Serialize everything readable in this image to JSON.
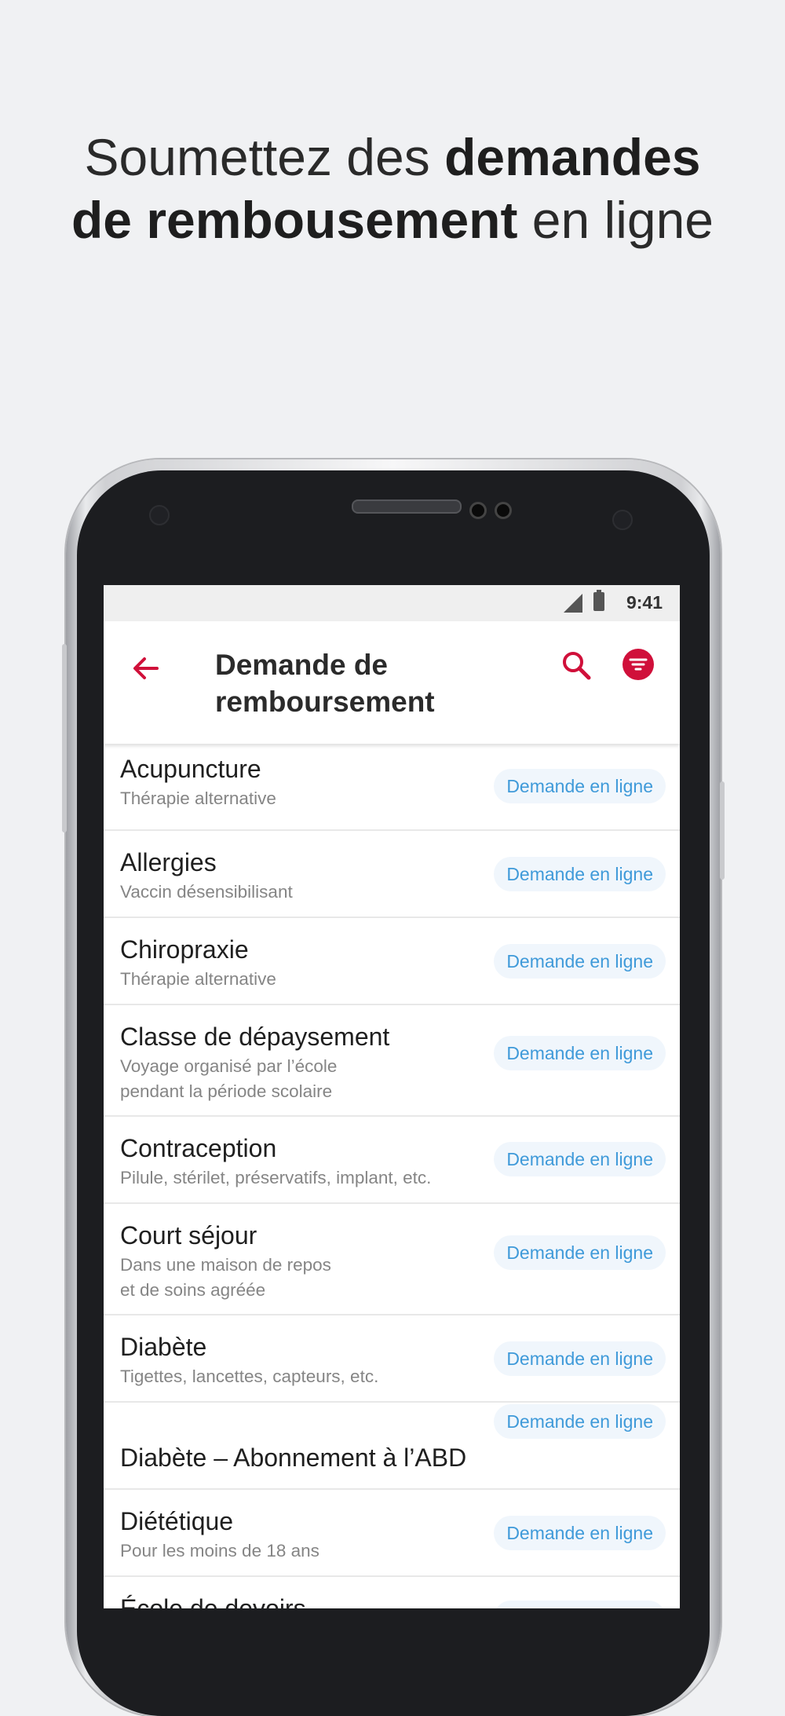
{
  "headline": {
    "line1_normal": "Soumettez des ",
    "line1_bold": "demandes",
    "line2_bold": "de rembousement",
    "line2_normal": " en ligne"
  },
  "statusbar": {
    "time": "9:41"
  },
  "appbar": {
    "title": "Demande de remboursement",
    "back_icon": "arrow-left-icon",
    "search_icon": "search-icon",
    "filter_icon": "filter-icon"
  },
  "colors": {
    "accent": "#d0103a",
    "pill_text": "#3f9ad9",
    "pill_bg": "#f0f6fc"
  },
  "items": [
    {
      "name": "Acupuncture",
      "sub": "Thérapie alternative",
      "action": "Demande en ligne"
    },
    {
      "name": "Allergies",
      "sub": "Vaccin désensibilisant",
      "action": "Demande en ligne"
    },
    {
      "name": "Chiropraxie",
      "sub": "Thérapie alternative",
      "action": "Demande en ligne"
    },
    {
      "name": "Classe de dépaysement",
      "sub": "Voyage organisé par l’école\npendant la période scolaire",
      "action": "Demande en ligne"
    },
    {
      "name": "Contraception",
      "sub": "Pilule, stérilet, préservatifs, implant, etc.",
      "action": "Demande en ligne"
    },
    {
      "name": "Court séjour",
      "sub": "Dans une maison de repos\net de soins agréée",
      "action": "Demande en ligne"
    },
    {
      "name": "Diabète",
      "sub": "Tigettes, lancettes, capteurs, etc.",
      "action": "Demande en ligne"
    },
    {
      "name": "Diabète – Abonnement à l’ABD",
      "sub": "",
      "action": "Demande en ligne"
    },
    {
      "name": "Diététique",
      "sub": "Pour les moins de 18 ans",
      "action": "Demande en ligne"
    },
    {
      "name": "École de devoirs",
      "sub": "",
      "action": "Demande en ligne"
    }
  ]
}
